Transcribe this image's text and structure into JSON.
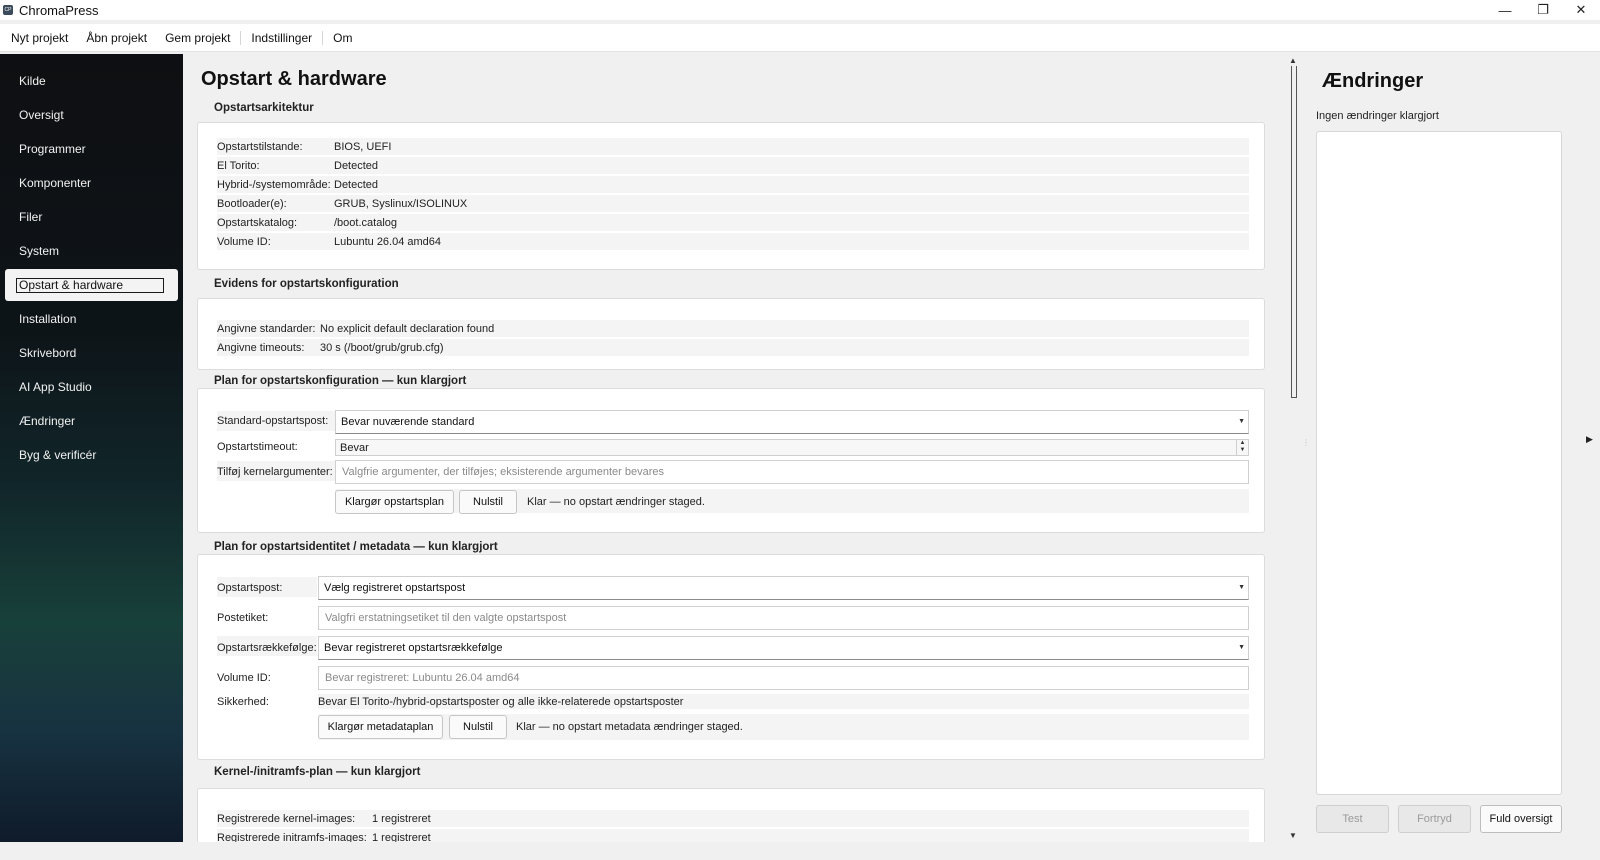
{
  "window": {
    "title": "ChromaPress",
    "icon_text": "CP",
    "controls": {
      "minimize": "—",
      "restore": "❐",
      "close": "✕"
    }
  },
  "menubar": [
    "Nyt projekt",
    "Åbn projekt",
    "Gem projekt",
    "Indstillinger",
    "Om"
  ],
  "sidebar": {
    "items": [
      {
        "label": "Kilde"
      },
      {
        "label": "Oversigt"
      },
      {
        "label": "Programmer"
      },
      {
        "label": "Komponenter"
      },
      {
        "label": "Filer"
      },
      {
        "label": "System"
      },
      {
        "label": "Opstart & hardware",
        "active": true
      },
      {
        "label": "Installation"
      },
      {
        "label": "Skrivebord"
      },
      {
        "label": "AI App Studio"
      },
      {
        "label": "Ændringer"
      },
      {
        "label": "Byg & verificér"
      }
    ]
  },
  "main": {
    "title": "Opstart & hardware",
    "boot_arch": {
      "title": "Opstartsarkitektur",
      "rows": [
        {
          "key": "Opstartstilstande:",
          "value": "BIOS, UEFI"
        },
        {
          "key": "El Torito:",
          "value": "Detected"
        },
        {
          "key": "Hybrid-/systemområde:",
          "value": "Detected"
        },
        {
          "key": "Bootloader(e):",
          "value": "GRUB, Syslinux/ISOLINUX"
        },
        {
          "key": "Opstartskatalog:",
          "value": "/boot.catalog"
        },
        {
          "key": "Volume ID:",
          "value": "Lubuntu 26.04 amd64"
        }
      ]
    },
    "evidence": {
      "title": "Evidens for opstartskonfiguration",
      "rows": [
        {
          "key": "Angivne standarder:",
          "value": "No explicit default declaration found"
        },
        {
          "key": "Angivne timeouts:",
          "value": "30 s (/boot/grub/grub.cfg)"
        }
      ]
    },
    "boot_plan": {
      "title": "Plan for opstartskonfiguration — kun klargjort",
      "default_entry_label": "Standard-opstartspost:",
      "default_entry_value": "Bevar nuværende standard",
      "timeout_label": "Opstartstimeout:",
      "timeout_value": "Bevar",
      "kernel_args_label": "Tilføj kernelargumenter:",
      "kernel_args_placeholder": "Valgfrie argumenter, der tilføjes; eksisterende argumenter bevares",
      "prepare_button": "Klargør opstartsplan",
      "reset_button": "Nulstil",
      "status": "Klar — no opstart ændringer staged."
    },
    "identity_plan": {
      "title": "Plan for opstartsidentitet / metadata — kun klargjort",
      "entry_label": "Opstartspost:",
      "entry_value": "Vælg registreret opstartspost",
      "entry_label_label": "Postetiket:",
      "entry_label_placeholder": "Valgfri erstatningsetiket til den valgte opstartspost",
      "order_label": "Opstartsrækkefølge:",
      "order_value": "Bevar registreret opstartsrækkefølge",
      "volume_label": "Volume ID:",
      "volume_placeholder": "Bevar registreret: Lubuntu 26.04 amd64",
      "safety_label": "Sikkerhed:",
      "safety_value": "Bevar El Torito-/hybrid-opstartsposter og alle ikke-relaterede opstartsposter",
      "prepare_button": "Klargør metadataplan",
      "reset_button": "Nulstil",
      "status": "Klar — no opstart metadata ændringer staged."
    },
    "kernel_plan": {
      "title": "Kernel-/initramfs-plan — kun klargjort",
      "rows": [
        {
          "key": "Registrerede kernel-images:",
          "value": "1 registreret"
        },
        {
          "key": "Registrerede initramfs-images:",
          "value": "1 registreret"
        }
      ]
    }
  },
  "right_panel": {
    "title": "Ændringer",
    "subtitle": "Ingen ændringer klargjort",
    "test_button": "Test",
    "undo_button": "Fortryd",
    "overview_button": "Fuld oversigt"
  }
}
